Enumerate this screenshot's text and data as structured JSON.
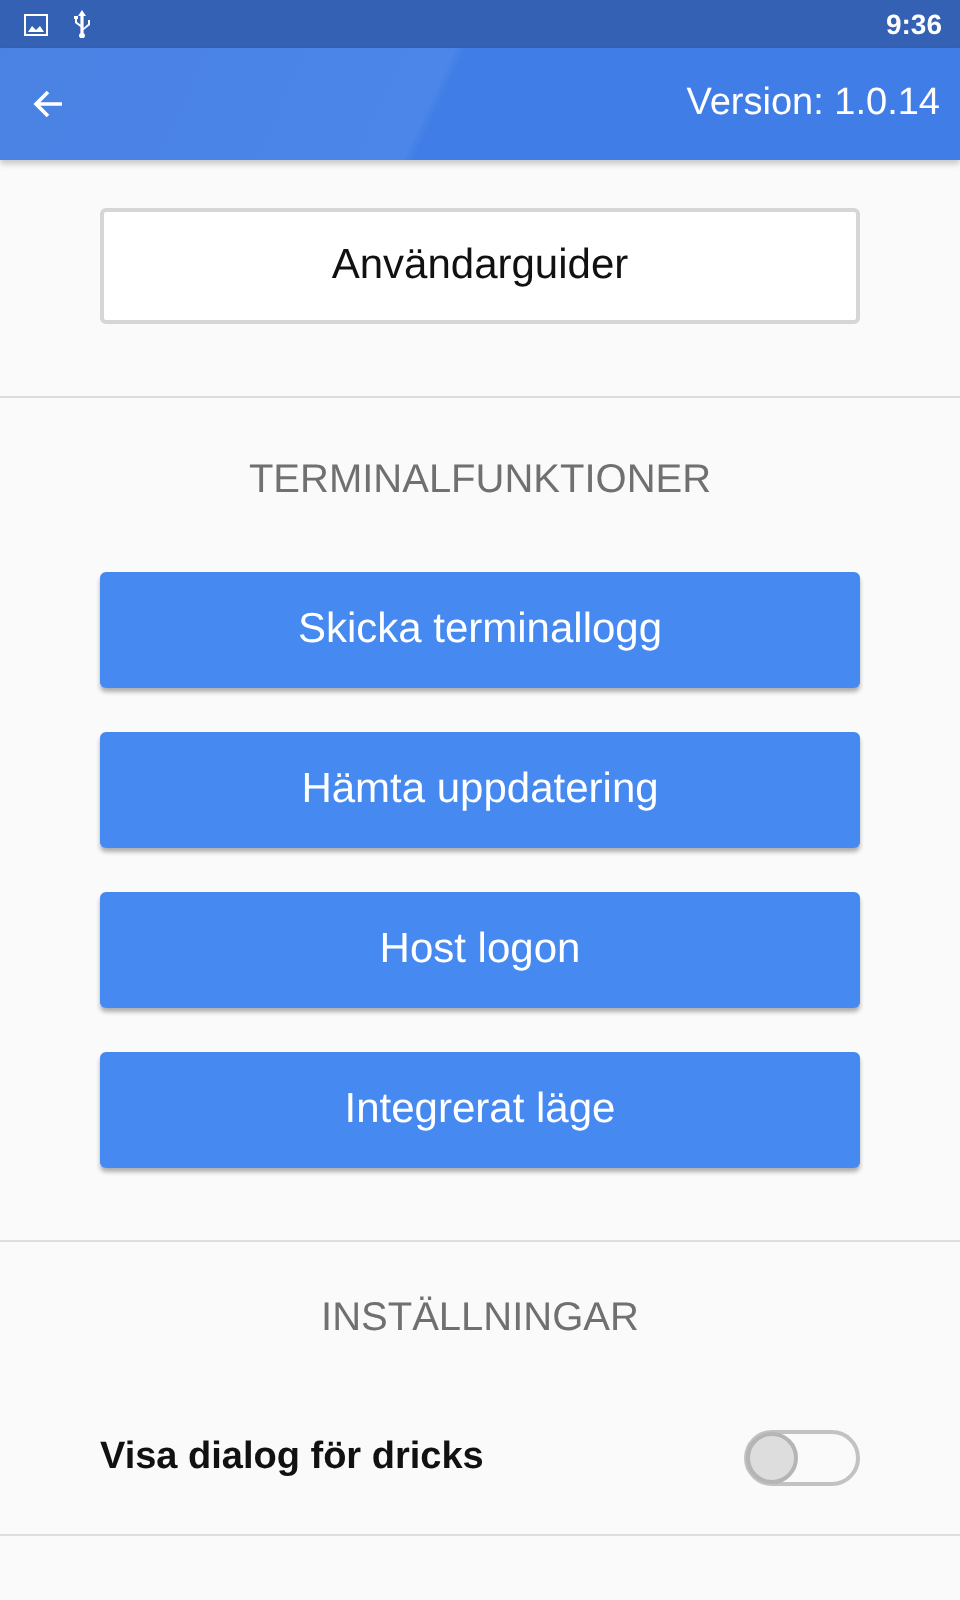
{
  "status_bar": {
    "time": "9:36"
  },
  "app_bar": {
    "version": "Version: 1.0.14"
  },
  "guide_button": "Användarguider",
  "terminal_section": {
    "heading": "TERMINALFUNKTIONER",
    "buttons": [
      "Skicka terminallogg",
      "Hämta uppdatering",
      "Host logon",
      "Integrerat läge"
    ]
  },
  "settings_section": {
    "heading": "INSTÄLLNINGAR",
    "items": [
      {
        "label": "Visa dialog för dricks",
        "kind": "switch",
        "on": false
      }
    ]
  }
}
